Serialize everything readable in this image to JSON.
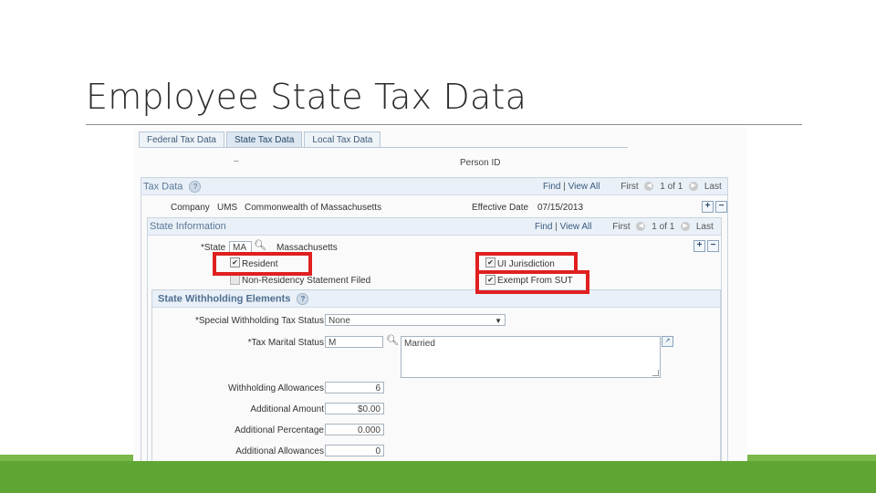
{
  "slide": {
    "title": "Employee State Tax Data"
  },
  "tabs": [
    {
      "label": "Federal Tax Data"
    },
    {
      "label": "State Tax Data"
    },
    {
      "label": "Local Tax Data"
    }
  ],
  "header": {
    "dash": "–",
    "person_label": "Person ID"
  },
  "tax_data": {
    "title": "Tax Data",
    "help": "?",
    "nav": {
      "find": "Find",
      "sep": "|",
      "view_all": "View All",
      "first": "First",
      "prev": "◀",
      "count": "1 of 1",
      "next": "▶",
      "last": "Last"
    },
    "company_label": "Company",
    "company_code": "UMS",
    "company_name": "Commonwealth of Massachusetts",
    "effective_date_label": "Effective Date",
    "effective_date": "07/15/2013",
    "add": "+",
    "remove": "−"
  },
  "state_info": {
    "title": "State Information",
    "nav": {
      "find": "Find",
      "sep": "|",
      "view_all": "View All",
      "first": "First",
      "prev": "◀",
      "count": "1 of 1",
      "next": "▶",
      "last": "Last"
    },
    "state_label": "*State",
    "state_value": "MA",
    "state_name": "Massachusetts",
    "resident_label": "Resident",
    "non_residency_label": "Non-Residency Statement Filed",
    "ui_jurisdiction_label": "UI Jurisdiction",
    "exempt_sut_label": "Exempt From SUT",
    "check": "✔",
    "add": "+",
    "remove": "−"
  },
  "withholding": {
    "title": "State Withholding Elements",
    "help": "?",
    "special_status_label": "*Special Withholding Tax Status",
    "special_status_value": "None",
    "marital_status_label": "*Tax Marital Status",
    "marital_status_code": "M",
    "marital_status_desc": "Married",
    "allowances_label": "Withholding Allowances",
    "allowances_value": "6",
    "additional_amount_label": "Additional Amount",
    "additional_amount_value": "$0.00",
    "additional_percentage_label": "Additional Percentage",
    "additional_percentage_value": "0.000",
    "additional_allowances_label": "Additional Allowances",
    "additional_allowances_value": "0"
  },
  "colors": {
    "highlight": "#e02020",
    "footer": "#5fa534"
  }
}
